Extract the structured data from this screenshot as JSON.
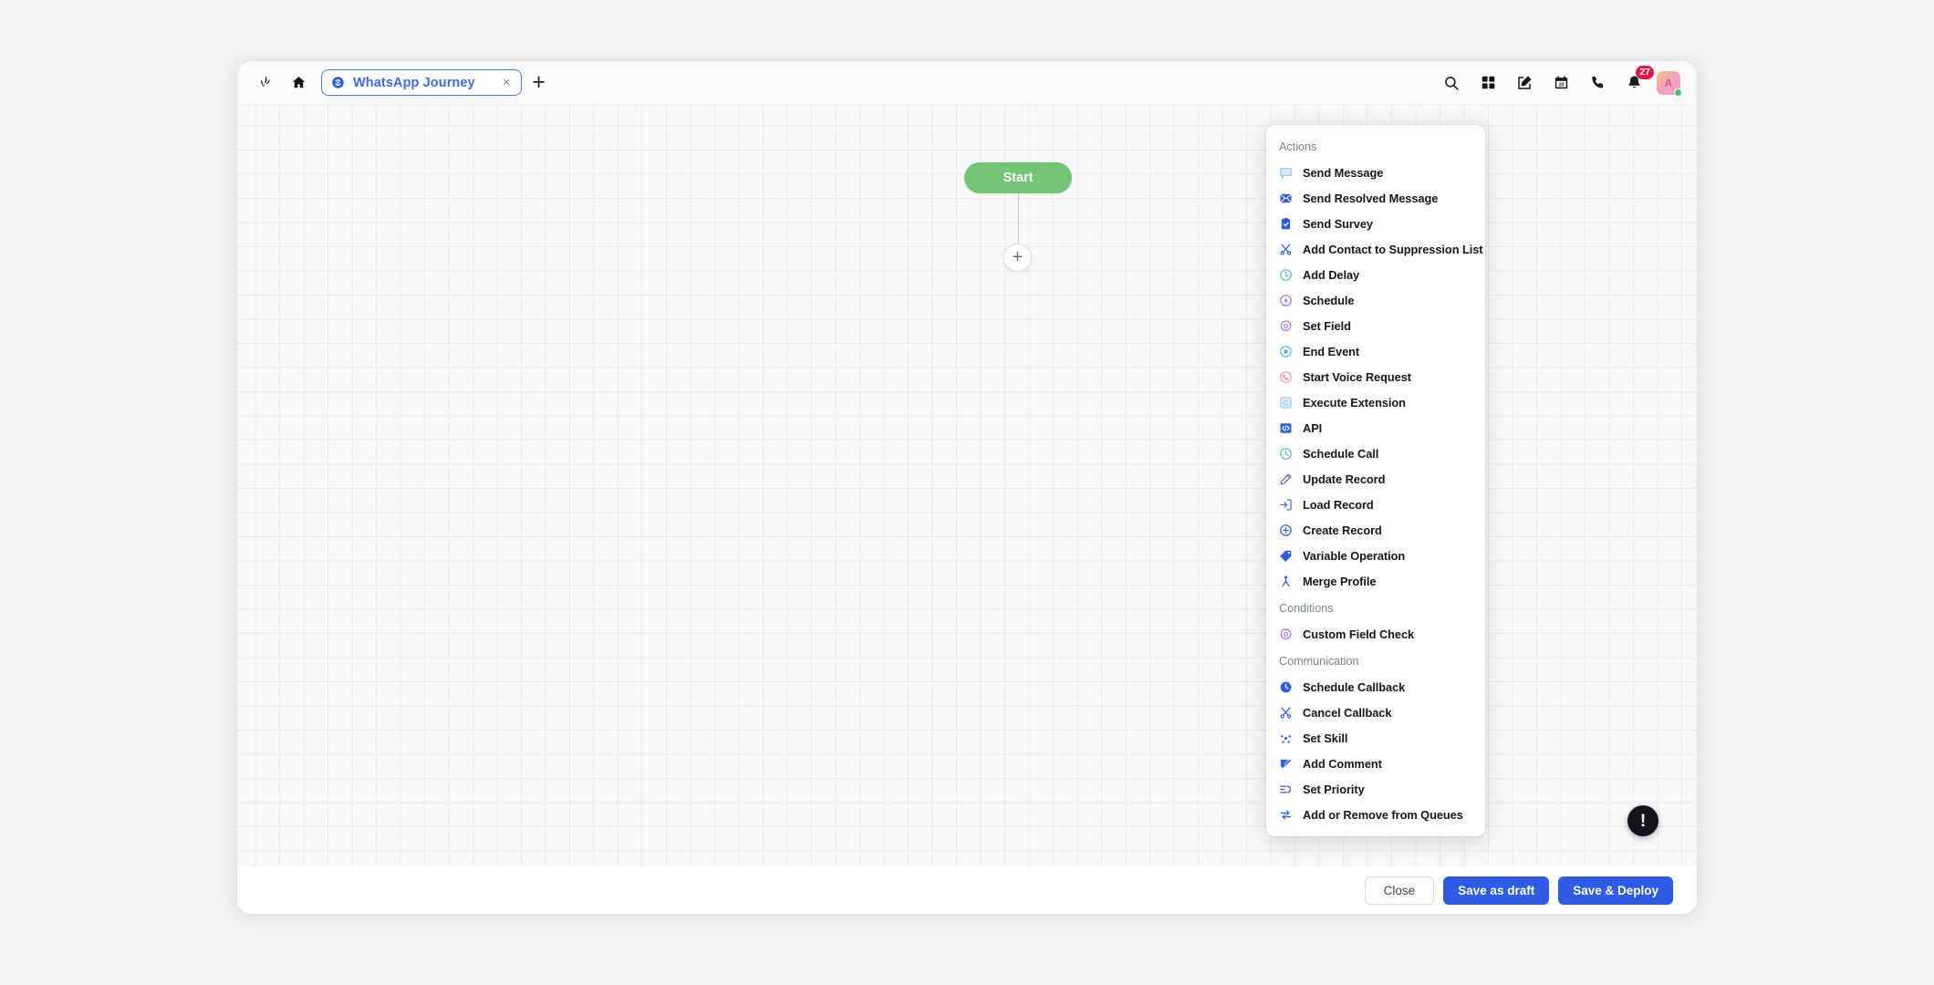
{
  "header": {
    "logo_icon": "sprout-logo-icon",
    "home_icon": "home-icon",
    "tab": {
      "icon": "journey-icon",
      "label": "WhatsApp Journey",
      "close_label": "×"
    },
    "add_tab_label": "+",
    "right_icons": [
      {
        "name": "search-icon",
        "label": "Search"
      },
      {
        "name": "apps-grid-icon",
        "label": "Apps"
      },
      {
        "name": "compose-icon",
        "label": "Compose"
      },
      {
        "name": "calendar-icon",
        "label": "Calendar",
        "day": "20"
      },
      {
        "name": "phone-icon",
        "label": "Phone"
      },
      {
        "name": "bell-icon",
        "label": "Notifications",
        "badge": "27"
      }
    ],
    "avatar": {
      "initial": "A",
      "status": "online"
    }
  },
  "canvas": {
    "start_node_label": "Start",
    "add_node_label": "+",
    "alert_label": "!"
  },
  "footer": {
    "close_label": "Close",
    "save_draft_label": "Save as draft",
    "save_deploy_label": "Save & Deploy"
  },
  "menu": {
    "sections": [
      {
        "title": "Actions",
        "items": [
          {
            "label": "Send Message",
            "icon": "speech-bubble-icon",
            "color": "#8ec6e8"
          },
          {
            "label": "Send Resolved Message",
            "icon": "envelope-check-icon",
            "color": "#2d5ce6"
          },
          {
            "label": "Send Survey",
            "icon": "clipboard-check-icon",
            "color": "#2d5ce6"
          },
          {
            "label": "Add Contact to Suppression List",
            "icon": "scissors-icon",
            "color": "#2d5ce6"
          },
          {
            "label": "Add Delay",
            "icon": "clock-icon",
            "color": "#5bb3d9"
          },
          {
            "label": "Schedule",
            "icon": "schedule-bolt-icon",
            "color": "#9b6cf0"
          },
          {
            "label": "Set Field",
            "icon": "gear-field-icon",
            "color": "#9b6cf0"
          },
          {
            "label": "End Event",
            "icon": "stop-circle-icon",
            "color": "#5bb3d9"
          },
          {
            "label": "Start Voice Request",
            "icon": "phone-circle-icon",
            "color": "#ec8ba8"
          },
          {
            "label": "Execute Extension",
            "icon": "extension-c-icon",
            "color": "#8ec6e8"
          },
          {
            "label": "API",
            "icon": "code-brackets-icon",
            "color": "#2d5ce6"
          },
          {
            "label": "Schedule Call",
            "icon": "clock-call-icon",
            "color": "#5bb3d9"
          },
          {
            "label": "Update Record",
            "icon": "pencil-icon",
            "color": "#4a63e8"
          },
          {
            "label": "Load Record",
            "icon": "import-arrow-icon",
            "color": "#4a63e8"
          },
          {
            "label": "Create Record",
            "icon": "plus-circle-icon",
            "color": "#2d5ce6"
          },
          {
            "label": "Variable Operation",
            "icon": "tag-icon",
            "color": "#2d5ce6"
          },
          {
            "label": "Merge Profile",
            "icon": "merge-icon",
            "color": "#2d5ce6"
          }
        ]
      },
      {
        "title": "Conditions",
        "items": [
          {
            "label": "Custom Field Check",
            "icon": "gear-check-icon",
            "color": "#9b6cf0"
          }
        ]
      },
      {
        "title": "Communication",
        "items": [
          {
            "label": "Schedule Callback",
            "icon": "clock-filled-icon",
            "color": "#2d5ce6"
          },
          {
            "label": "Cancel Callback",
            "icon": "scissors-icon",
            "color": "#2d5ce6"
          },
          {
            "label": "Set Skill",
            "icon": "skill-nodes-icon",
            "color": "#2d5ce6"
          },
          {
            "label": "Add Comment",
            "icon": "comment-edit-icon",
            "color": "#2d5ce6"
          },
          {
            "label": "Set Priority",
            "icon": "priority-lines-icon",
            "color": "#2d5ce6"
          },
          {
            "label": "Add or Remove from Queues",
            "icon": "swap-arrows-icon",
            "color": "#2d5ce6"
          }
        ]
      }
    ]
  },
  "colors": {
    "accent": "#2e5ce6",
    "start_node": "#72c476",
    "badge": "#e8154a",
    "tab_active": "#3a6cf0"
  }
}
